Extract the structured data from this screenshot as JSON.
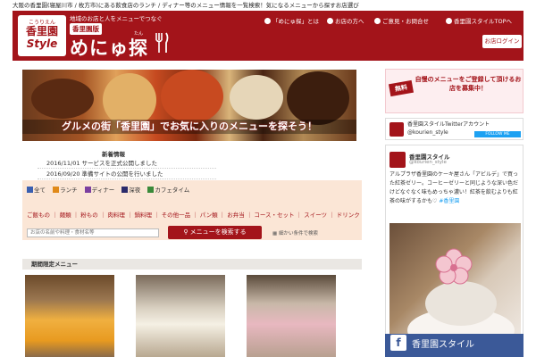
{
  "top_strip": "大阪の香里園(寝屋川市 / 枚方市)にある飲食店のランチ / ディナー等のメニュー情報を一覧検索！気になるメニューから探すお店選び",
  "header": {
    "logo_small": "こうりえん",
    "logo_mid": "香里園",
    "logo_big": "Style",
    "tagline": "地域のお店と人をメニューでつなぐ",
    "edition": "香里園版",
    "brand": "めにゅ探",
    "brand_ruby": "たん",
    "nav": [
      "「めにゅ探」とは",
      "お店の方へ",
      "ご意見・お問合せ",
      "香里園スタイルTOPへ"
    ],
    "login_label": "お店ログイン"
  },
  "hero": {
    "caption": "グルメの街「香里園」でお気に入りのメニューを探そう！"
  },
  "news": {
    "title": "新着情報",
    "items": [
      "2016/11/01  サービスを正式公開しました",
      "2016/09/20  準備サイトの公開を行いました"
    ]
  },
  "search": {
    "tabs": [
      {
        "icon": "全",
        "label": "全て",
        "color": "#3a5fb0"
      },
      {
        "icon": "ラ",
        "label": "ランチ",
        "color": "#e08a1a"
      },
      {
        "icon": "デ",
        "label": "ディナー",
        "color": "#7b3fa0"
      },
      {
        "icon": "深",
        "label": "深夜",
        "color": "#2b2b6b"
      },
      {
        "icon": "カ",
        "label": "カフェタイム",
        "color": "#3a8a3a"
      }
    ],
    "categories": "ご飯もの ｜ 麺類 ｜ 粉もの ｜ 肉料理 ｜ 鍋料理 ｜ その他一品 ｜ パン類 ｜ お弁当 ｜ コース・セット ｜ スイーツ ｜ ドリンク",
    "input_placeholder": "お店の名前や料理・食材名等",
    "button_label": "メニューを検索する",
    "advanced_label": "細かい条件で検索"
  },
  "limited": {
    "title": "期間限定メニュー"
  },
  "sidebar": {
    "ad_badge": "無料",
    "ad_text": "自慢のメニューをご登録して頂けるお店を募集中！",
    "twitter_account_line1": "香里園スタイルTwitterアカウント",
    "twitter_account_line2": "@kourien_style",
    "follow_label": "FOLLOW ME",
    "tweet_name": "香里園スタイル",
    "tweet_handle": "@kourien_style",
    "tweet_body": "アルプラザ香里園のケーキ屋さん「アビルデ」で買った紅茶ゼリー。コーヒーゼリーと同じような深い色だけどなぐなく味もめっちゃ濃い！紅茶を飲むよりも紅茶の味がするかも♡",
    "tweet_tag": "#香里園",
    "facebook_label": "香里園スタイル"
  },
  "colors": {
    "brand_red": "#a3141a",
    "panel_bg": "#fbe6d6",
    "facebook_blue": "#3b5998"
  }
}
